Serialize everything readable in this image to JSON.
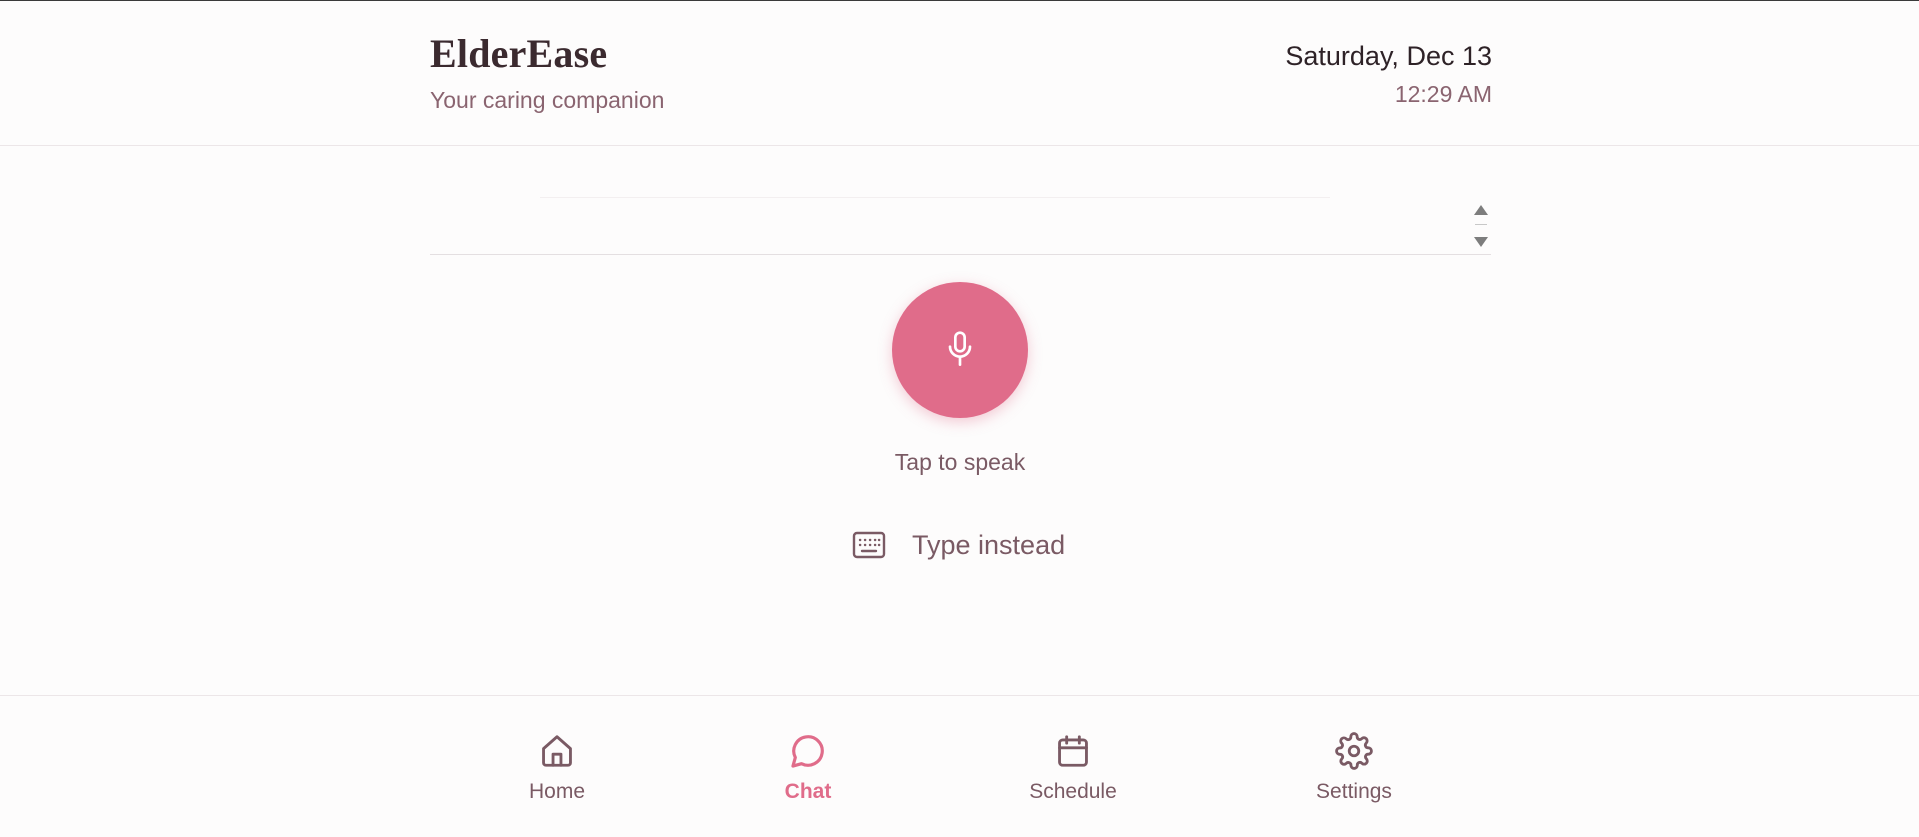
{
  "header": {
    "title": "ElderEase",
    "subtitle": "Your caring companion",
    "date": "Saturday, Dec 13",
    "time": "12:29 AM"
  },
  "voice": {
    "mic_icon": "microphone-icon",
    "tap_label": "Tap to speak"
  },
  "type_instead": {
    "icon": "keyboard-icon",
    "label": "Type instead"
  },
  "nav": {
    "items": [
      {
        "label": "Home",
        "icon": "home-icon",
        "active": false
      },
      {
        "label": "Chat",
        "icon": "chat-bubble-icon",
        "active": true
      },
      {
        "label": "Schedule",
        "icon": "calendar-icon",
        "active": false
      },
      {
        "label": "Settings",
        "icon": "gear-icon",
        "active": false
      }
    ]
  },
  "colors": {
    "accent": "#e06c8a",
    "text_muted": "#7a5a64",
    "title": "#3b2a2f"
  }
}
